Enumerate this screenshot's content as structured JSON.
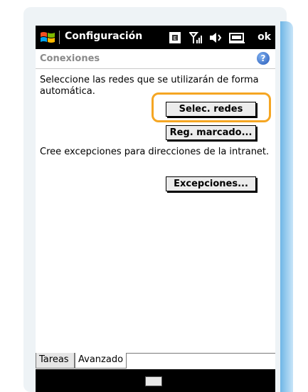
{
  "titlebar": {
    "title": "Configuración",
    "ok_label": "ok"
  },
  "icons": {
    "start": "windows-flag-icon",
    "sim": "sim-card-icon",
    "signal": "signal-strength-icon",
    "volume": "speaker-icon",
    "battery": "battery-icon",
    "help": "help-icon",
    "keyboard": "keyboard-icon"
  },
  "header": {
    "title": "Conexiones",
    "help_glyph": "?"
  },
  "content": {
    "intro_text": "Seleccione las redes que se utilizarán de forma automática.",
    "select_networks_button": "Selec. redes",
    "dialing_rules_button": "Reg. marcado...",
    "exceptions_text": "Cree excepciones para direcciones de la intranet.",
    "exceptions_button": "Excepciones..."
  },
  "tabs": [
    {
      "label": "Tareas",
      "active": false
    },
    {
      "label": "Avanzado",
      "active": true
    }
  ],
  "colors": {
    "highlight": "#f5a623",
    "help_blue": "#2759b8",
    "titlebar_bg": "#000000"
  }
}
